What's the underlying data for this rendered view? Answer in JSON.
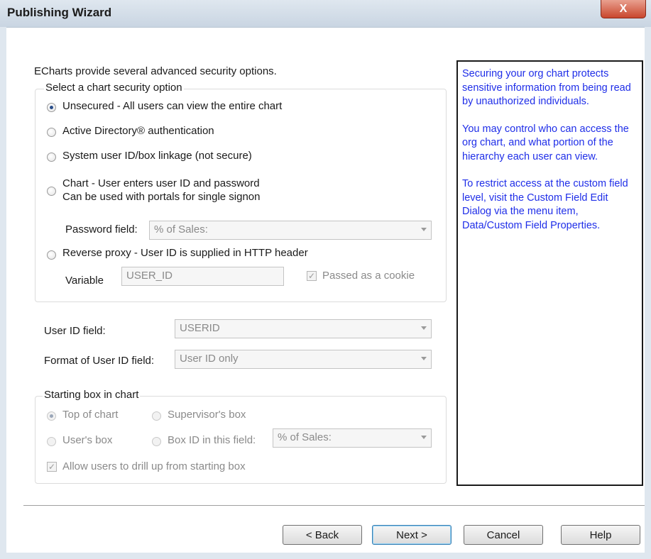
{
  "window": {
    "title": "Publishing Wizard",
    "close_label": "X"
  },
  "intro": "ECharts provide several advanced security options.",
  "security_group": {
    "legend": "Select a chart security option",
    "options": [
      {
        "label": "Unsecured - All users can view the entire chart",
        "checked": true
      },
      {
        "label": "Active Directory® authentication",
        "checked": false
      },
      {
        "label": "System user ID/box linkage (not secure)",
        "checked": false
      },
      {
        "label": "Chart - User enters user ID and password",
        "label2": "Can be used with portals for single signon",
        "checked": false
      },
      {
        "label": "Reverse proxy - User ID is supplied in HTTP header",
        "checked": false
      }
    ],
    "password_field": {
      "label": "Password field:",
      "value": "% of Sales:"
    },
    "variable": {
      "label": "Variable",
      "value": "USER_ID"
    },
    "cookie": {
      "label": "Passed as a cookie",
      "checked": true
    }
  },
  "user_id_field": {
    "label": "User ID field:",
    "value": "USERID"
  },
  "format_field": {
    "label": "Format of User ID field:",
    "value": "User ID only"
  },
  "starting_group": {
    "legend": "Starting box in chart",
    "top_of_chart": "Top of chart",
    "supervisors_box": "Supervisor's box",
    "users_box": "User's box",
    "box_id_field": "Box ID in this field:",
    "box_id_value": "% of Sales:",
    "drill_up": "Allow users to drill up from starting box"
  },
  "help": {
    "p1": "Securing your org chart protects sensitive information from being read by unauthorized individuals.",
    "p2": "You may control who can access the org chart, and what portion of the hierarchy each user can view.",
    "p3": "To restrict access at the custom field level, visit the Custom Field Edit Dialog via the menu item, Data/Custom Field Properties."
  },
  "buttons": {
    "back": "< Back",
    "next": "Next >",
    "cancel": "Cancel",
    "help": "Help"
  }
}
